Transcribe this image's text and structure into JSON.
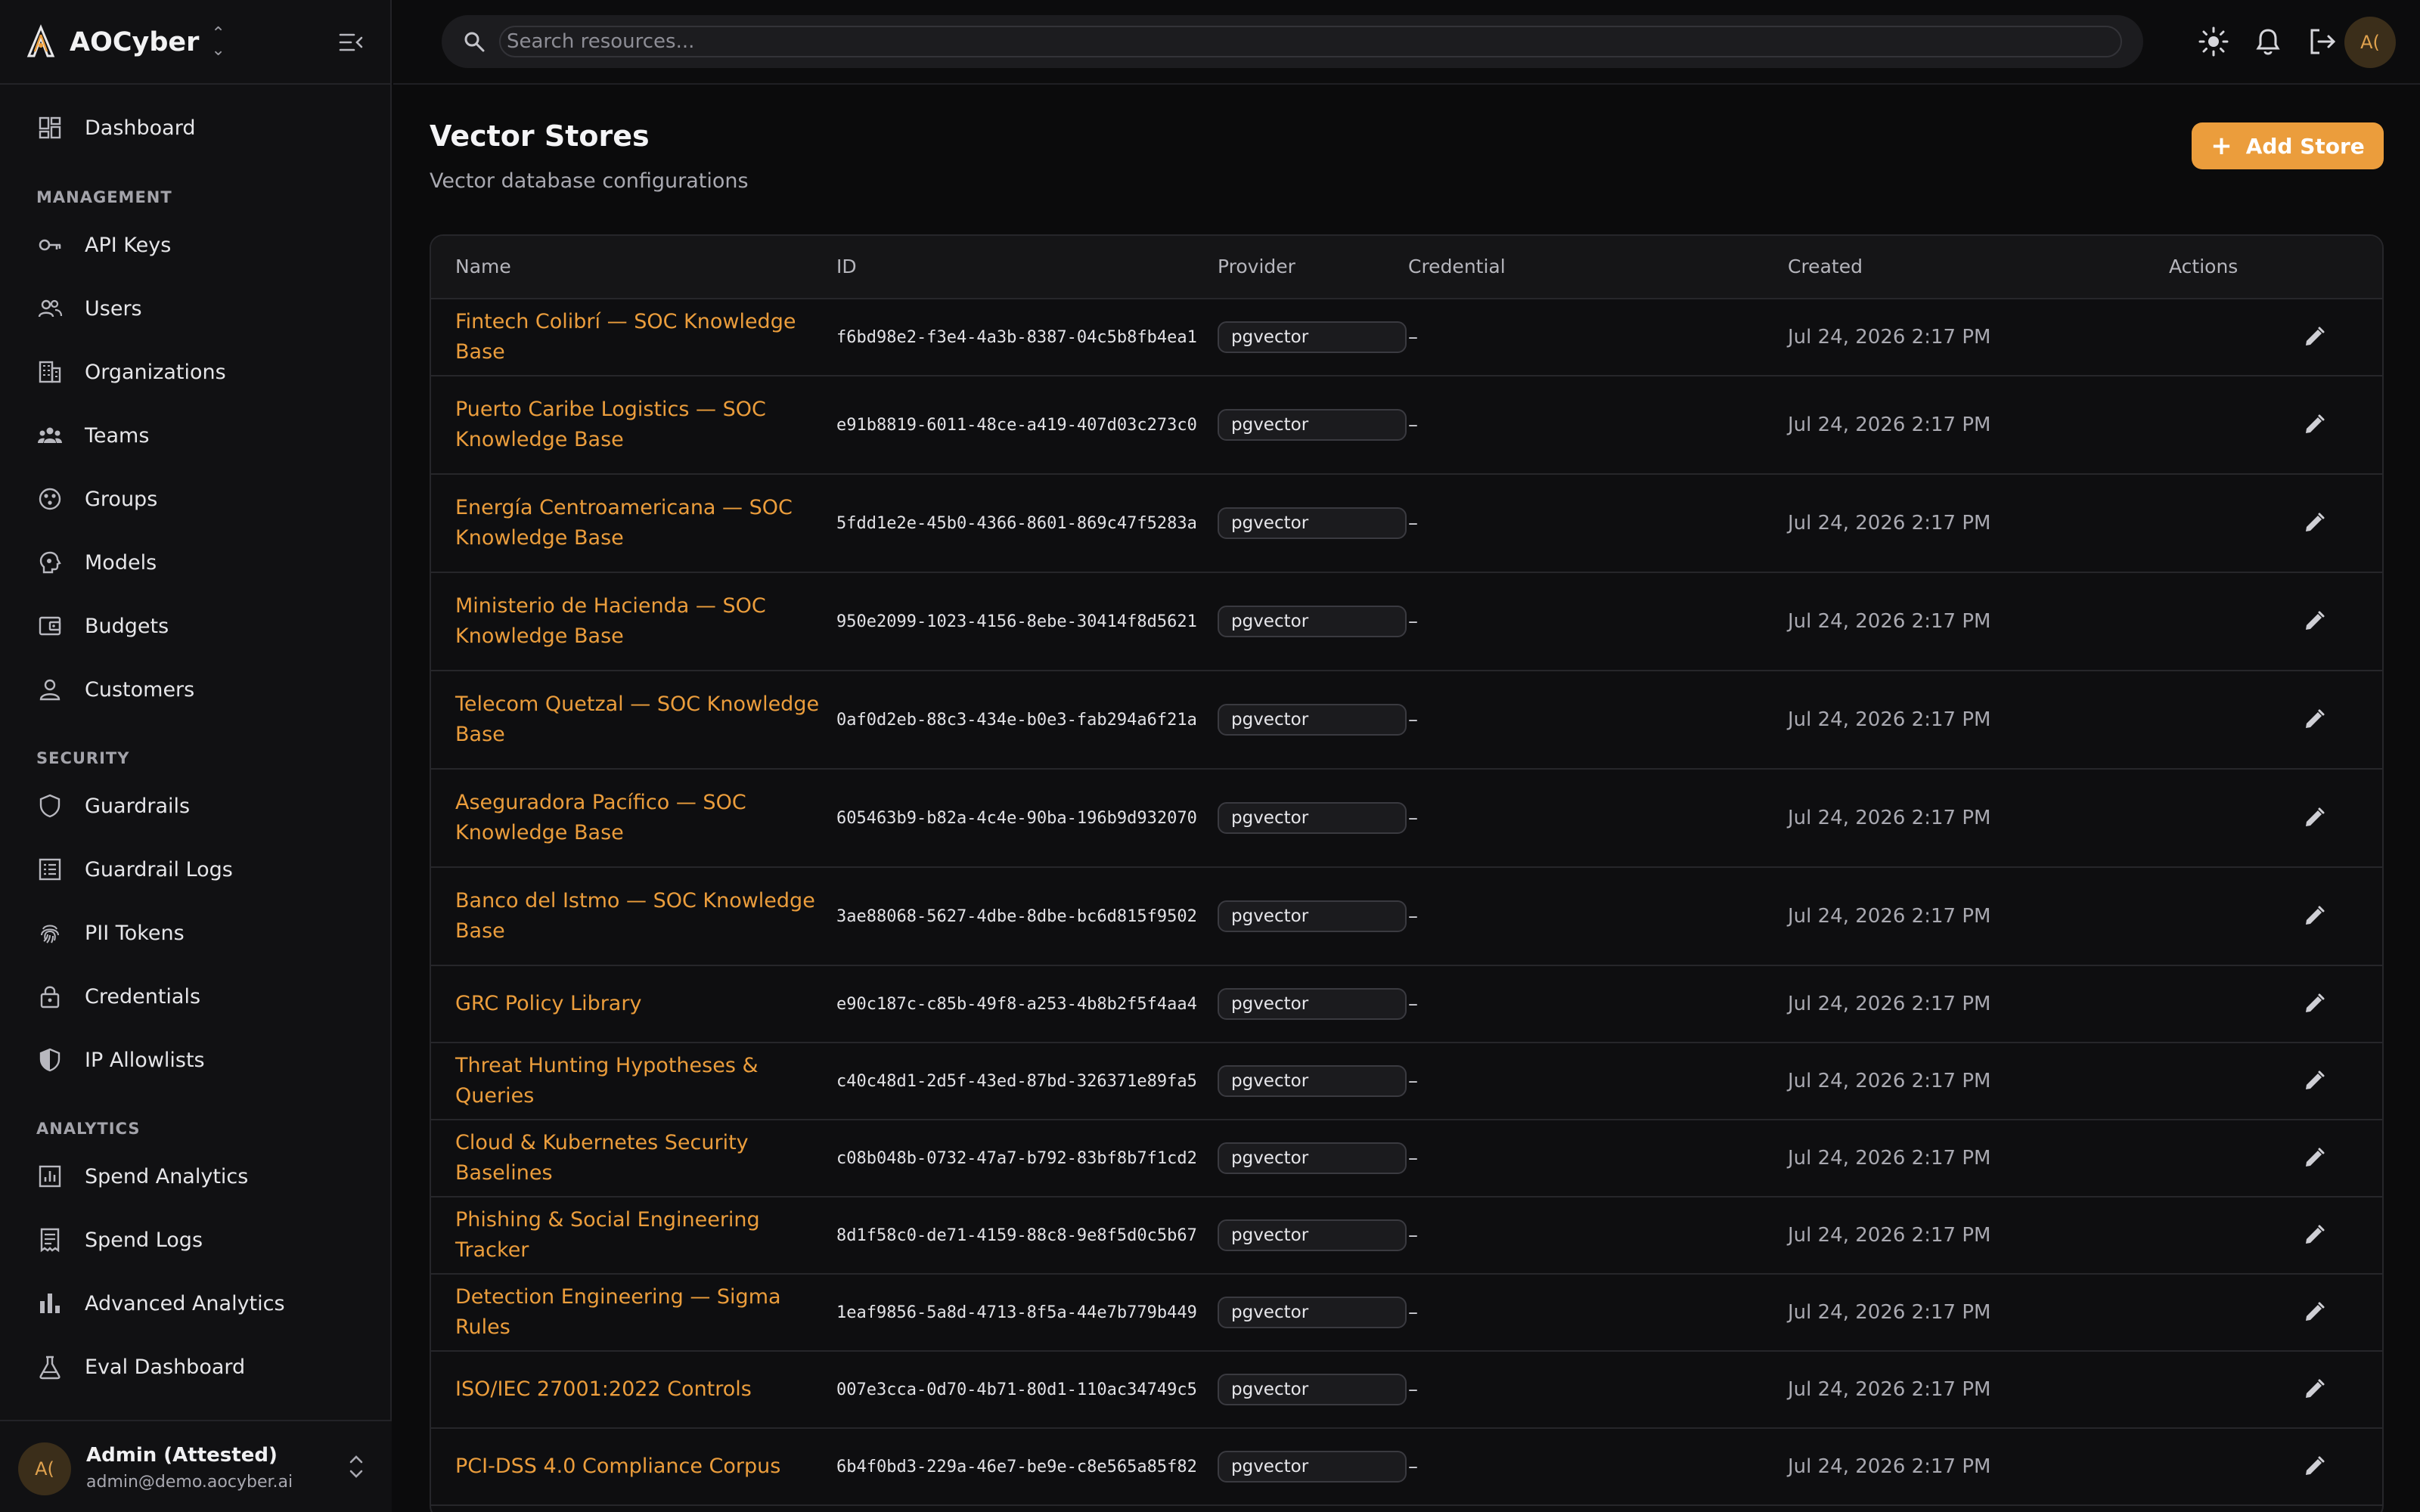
{
  "brand": {
    "name": "AOCyber"
  },
  "nav": {
    "dashboard": "Dashboard",
    "management_label": "MANAGEMENT",
    "api_keys": "API Keys",
    "users": "Users",
    "organizations": "Organizations",
    "teams": "Teams",
    "groups": "Groups",
    "models": "Models",
    "budgets": "Budgets",
    "customers": "Customers",
    "security_label": "SECURITY",
    "guardrails": "Guardrails",
    "guardrail_logs": "Guardrail Logs",
    "pii_tokens": "PII Tokens",
    "credentials": "Credentials",
    "ip_allowlists": "IP Allowlists",
    "analytics_label": "ANALYTICS",
    "spend_analytics": "Spend Analytics",
    "spend_logs": "Spend Logs",
    "advanced_analytics": "Advanced Analytics",
    "eval_dashboard": "Eval Dashboard"
  },
  "user": {
    "initials": "A(",
    "name": "Admin (Attested)",
    "email": "admin@demo.aocyber.ai"
  },
  "search": {
    "placeholder": "Search resources..."
  },
  "page": {
    "title": "Vector Stores",
    "subtitle": "Vector database configurations",
    "add_label": "Add Store"
  },
  "table": {
    "headers": {
      "name": "Name",
      "id": "ID",
      "provider": "Provider",
      "credential": "Credential",
      "created": "Created",
      "actions": "Actions"
    },
    "rows": [
      {
        "name": "Fintech Colibrí — SOC Knowledge Base",
        "id": "f6bd98e2-f3e4-4a3b-8387-04c5b8fb4ea1",
        "provider": "pgvector",
        "credential": "–",
        "created": "Jul 24, 2026 2:17 PM"
      },
      {
        "name": "Puerto Caribe Logistics — SOC Knowledge Base",
        "id": "e91b8819-6011-48ce-a419-407d03c273c0",
        "provider": "pgvector",
        "credential": "–",
        "created": "Jul 24, 2026 2:17 PM"
      },
      {
        "name": "Energía Centroamericana — SOC Knowledge Base",
        "id": "5fdd1e2e-45b0-4366-8601-869c47f5283a",
        "provider": "pgvector",
        "credential": "–",
        "created": "Jul 24, 2026 2:17 PM"
      },
      {
        "name": "Ministerio de Hacienda — SOC Knowledge Base",
        "id": "950e2099-1023-4156-8ebe-30414f8d5621",
        "provider": "pgvector",
        "credential": "–",
        "created": "Jul 24, 2026 2:17 PM"
      },
      {
        "name": "Telecom Quetzal — SOC Knowledge Base",
        "id": "0af0d2eb-88c3-434e-b0e3-fab294a6f21a",
        "provider": "pgvector",
        "credential": "–",
        "created": "Jul 24, 2026 2:17 PM"
      },
      {
        "name": "Aseguradora Pacífico — SOC Knowledge Base",
        "id": "605463b9-b82a-4c4e-90ba-196b9d932070",
        "provider": "pgvector",
        "credential": "–",
        "created": "Jul 24, 2026 2:17 PM"
      },
      {
        "name": "Banco del Istmo — SOC Knowledge Base",
        "id": "3ae88068-5627-4dbe-8dbe-bc6d815f9502",
        "provider": "pgvector",
        "credential": "–",
        "created": "Jul 24, 2026 2:17 PM"
      },
      {
        "name": "GRC Policy Library",
        "id": "e90c187c-c85b-49f8-a253-4b8b2f5f4aa4",
        "provider": "pgvector",
        "credential": "–",
        "created": "Jul 24, 2026 2:17 PM"
      },
      {
        "name": "Threat Hunting Hypotheses & Queries",
        "id": "c40c48d1-2d5f-43ed-87bd-326371e89fa5",
        "provider": "pgvector",
        "credential": "–",
        "created": "Jul 24, 2026 2:17 PM"
      },
      {
        "name": "Cloud & Kubernetes Security Baselines",
        "id": "c08b048b-0732-47a7-b792-83bf8b7f1cd2",
        "provider": "pgvector",
        "credential": "–",
        "created": "Jul 24, 2026 2:17 PM"
      },
      {
        "name": "Phishing & Social Engineering Tracker",
        "id": "8d1f58c0-de71-4159-88c8-9e8f5d0c5b67",
        "provider": "pgvector",
        "credential": "–",
        "created": "Jul 24, 2026 2:17 PM"
      },
      {
        "name": "Detection Engineering — Sigma Rules",
        "id": "1eaf9856-5a8d-4713-8f5a-44e7b779b449",
        "provider": "pgvector",
        "credential": "–",
        "created": "Jul 24, 2026 2:17 PM"
      },
      {
        "name": "ISO/IEC 27001:2022 Controls",
        "id": "007e3cca-0d70-4b71-80d1-110ac34749c5",
        "provider": "pgvector",
        "credential": "–",
        "created": "Jul 24, 2026 2:17 PM"
      },
      {
        "name": "PCI-DSS 4.0 Compliance Corpus",
        "id": "6b4f0bd3-229a-46e7-be9e-c8e565a85f82",
        "provider": "pgvector",
        "credential": "–",
        "created": "Jul 24, 2026 2:17 PM"
      }
    ]
  },
  "colors": {
    "accent": "#eb9d3c",
    "background": "#0b0b0c",
    "sidebar": "#111113"
  }
}
